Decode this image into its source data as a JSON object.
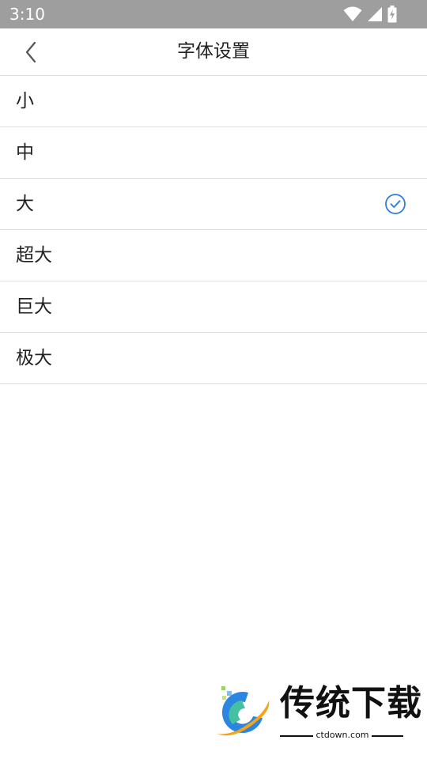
{
  "status_bar": {
    "time": "3:10",
    "icons": [
      "wifi-icon",
      "cellular-signal-icon",
      "battery-charging-icon"
    ]
  },
  "header": {
    "title": "字体设置",
    "back_icon": "chevron-left-icon"
  },
  "font_sizes": {
    "items": [
      {
        "label": "小",
        "selected": false
      },
      {
        "label": "中",
        "selected": false
      },
      {
        "label": "大",
        "selected": true
      },
      {
        "label": "超大",
        "selected": false
      },
      {
        "label": "巨大",
        "selected": false
      },
      {
        "label": "极大",
        "selected": false
      }
    ],
    "selected_icon": "check-circle-icon"
  },
  "watermark": {
    "title": "传统下载",
    "url": "ctdown.com"
  },
  "colors": {
    "status_bar": "#9e9e9e",
    "accent": "#2f7fd8",
    "divider": "#dedede",
    "text": "#222222"
  }
}
